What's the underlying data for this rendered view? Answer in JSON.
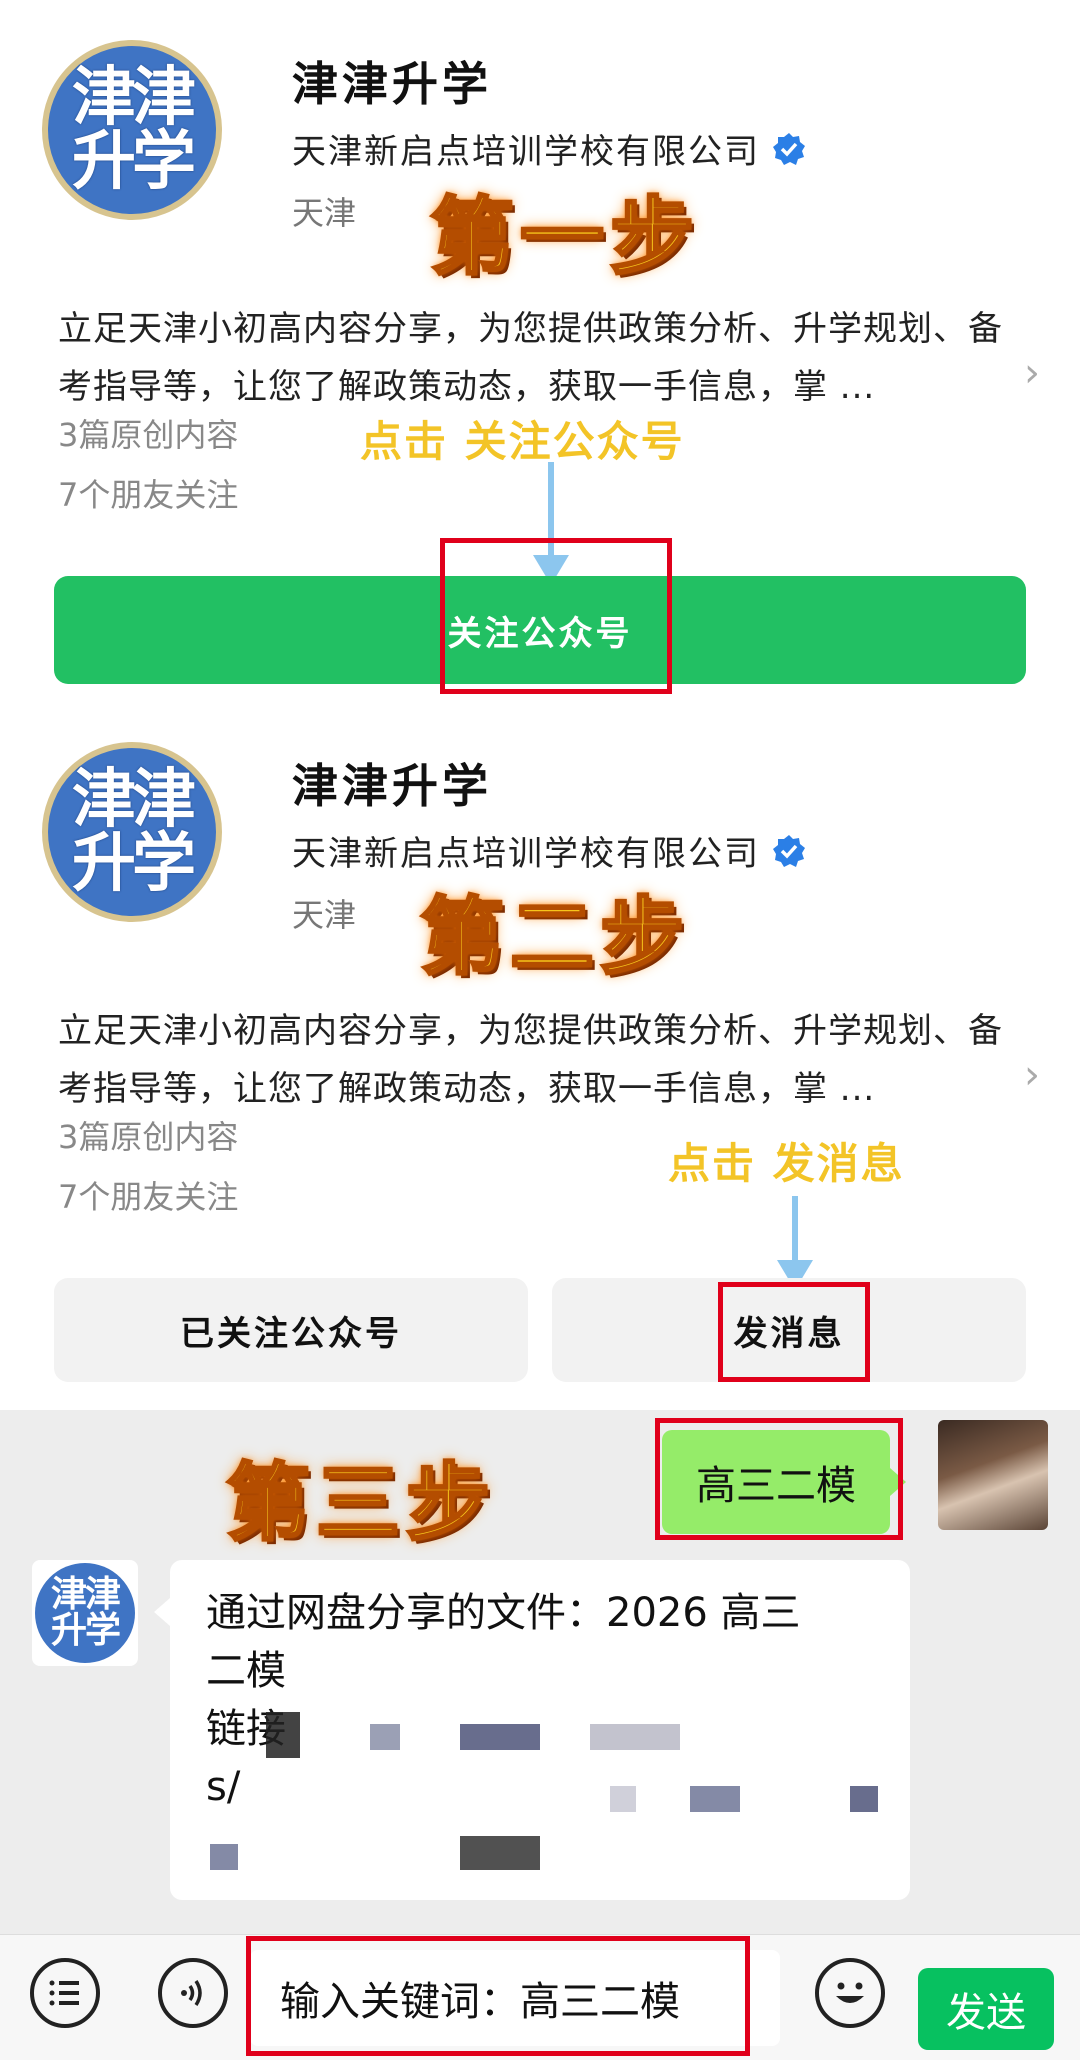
{
  "account": {
    "avatar_text_top": "津津",
    "avatar_text_bottom": "升学",
    "name": "津津升学",
    "organization": "天津新启点培训学校有限公司",
    "location": "天津",
    "description": "立足天津小初高内容分享，为您提供政策分析、升学规划、备考指导等，让您了解政策动态，获取一手信息，掌 ...",
    "original_count": "3篇原创内容",
    "friends_following": "7个朋友关注"
  },
  "step1": {
    "label": "第一步",
    "hint": "点击 关注公众号",
    "follow_button": "关注公众号"
  },
  "step2": {
    "label": "第二步",
    "hint": "点击 发消息",
    "followed_button": "已关注公众号",
    "message_button": "发消息"
  },
  "step3": {
    "label": "第三步",
    "sent_message": "高三二模",
    "reply_line1": "通过网盘分享的文件：2026 高三",
    "reply_line2": "二模",
    "reply_line3": "链接",
    "reply_line4": "s/"
  },
  "input_bar": {
    "input_text": "输入关键词：高三二模",
    "send_label": "发送"
  },
  "colors": {
    "follow_green": "#22c063",
    "send_green": "#07c160",
    "bubble_green": "#95ec69",
    "highlight_red": "#e0001b",
    "step_gold": "#f6c51c",
    "arrow_blue": "#8cc6ee"
  },
  "icons": [
    "verified-icon",
    "chevron-right-icon",
    "menu-icon",
    "voice-icon",
    "emoji-icon"
  ]
}
